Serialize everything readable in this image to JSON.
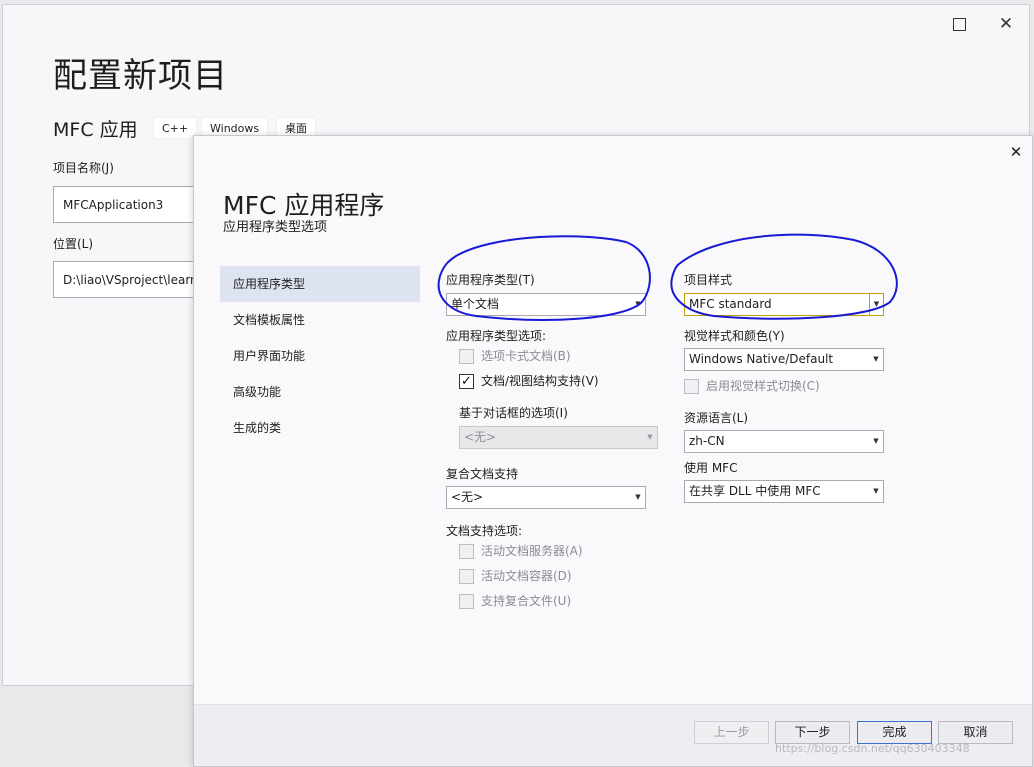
{
  "background": {
    "title": "配置新项目",
    "subtitle": "MFC 应用",
    "tags": [
      "C++",
      "Windows",
      "桌面"
    ],
    "project_name_label": "项目名称(J)",
    "project_name_value": "MFCApplication3",
    "location_label": "位置(L)",
    "location_value": "D:\\liao\\VSproject\\learn",
    "close_glyph": "✕"
  },
  "dialog": {
    "title": "MFC 应用程序",
    "subtitle": "应用程序类型选项",
    "close_glyph": "✕",
    "nav": [
      {
        "label": "应用程序类型",
        "active": true
      },
      {
        "label": "文档模板属性",
        "active": false
      },
      {
        "label": "用户界面功能",
        "active": false
      },
      {
        "label": "高级功能",
        "active": false
      },
      {
        "label": "生成的类",
        "active": false
      }
    ],
    "left": {
      "app_type_label": "应用程序类型(T)",
      "app_type_value": "单个文档",
      "app_type_options_label": "应用程序类型选项:",
      "tabbed_docs": {
        "label": "选项卡式文档(B)",
        "checked": false,
        "enabled": false
      },
      "doc_view": {
        "label": "文档/视图结构支持(V)",
        "checked": true,
        "enabled": true
      },
      "dialog_options_label": "基于对话框的选项(I)",
      "dialog_options_value": "<无>",
      "compound_label": "复合文档支持",
      "compound_value": "<无>",
      "doc_support_label": "文档支持选项:",
      "active_server": {
        "label": "活动文档服务器(A)",
        "checked": false,
        "enabled": false
      },
      "active_container": {
        "label": "活动文档容器(D)",
        "checked": false,
        "enabled": false
      },
      "compound_files": {
        "label": "支持复合文件(U)",
        "checked": false,
        "enabled": false
      }
    },
    "right": {
      "project_style_label": "项目样式",
      "project_style_value": "MFC standard",
      "visual_style_label": "视觉样式和颜色(Y)",
      "visual_style_value": "Windows Native/Default",
      "visual_switch": {
        "label": "启用视觉样式切换(C)",
        "checked": false,
        "enabled": false
      },
      "resource_lang_label": "资源语言(L)",
      "resource_lang_value": "zh-CN",
      "use_mfc_label": "使用 MFC",
      "use_mfc_value": "在共享 DLL 中使用 MFC"
    },
    "buttons": {
      "prev": "上一步",
      "next": "下一步",
      "finish": "完成",
      "cancel": "取消"
    },
    "watermark": "https://blog.csdn.net/qq630403348",
    "colors": {
      "annotation_ink": "#1a1ad6",
      "focus_border": "#c4a200",
      "nav_active": "#dde3f0",
      "primary_border": "#3d6fd0"
    }
  }
}
